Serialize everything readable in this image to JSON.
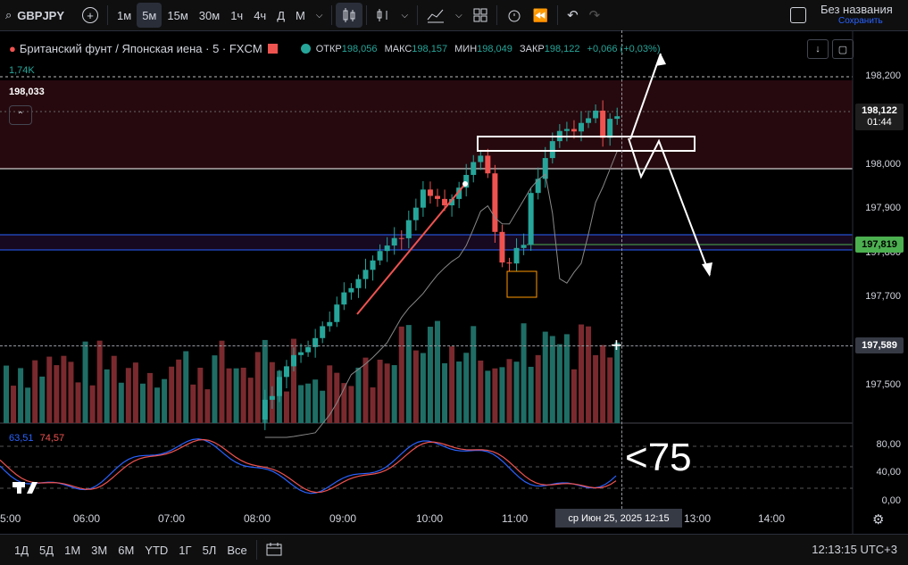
{
  "toolbar": {
    "symbol": "GBPJPY",
    "intervals": [
      "1м",
      "5м",
      "15м",
      "30м",
      "1ч",
      "4ч",
      "Д",
      "М"
    ],
    "active_interval": "5м",
    "layout_title": "Без названия",
    "layout_sub": "Сохранить"
  },
  "legend": {
    "title": "Британский фунт / Японская иена · 5 · FXCM",
    "open_lbl": "ОТКР",
    "open": "198,056",
    "high_lbl": "МАКС",
    "high": "198,157",
    "low_lbl": "МИН",
    "low": "198,049",
    "close_lbl": "ЗАКР",
    "close": "198,122",
    "change": "+0,066 (+0,03%)",
    "volume": "1,74K",
    "crosshair_price": "198,033"
  },
  "price_axis": {
    "ticks": [
      "198,200",
      "198,000",
      "197,900",
      "197,800",
      "197,700",
      "197,500"
    ],
    "current_price": "198,122",
    "countdown": "01:44",
    "level_price": "197,819",
    "cross_price": "197,589"
  },
  "rsi": {
    "value1": "63,51",
    "value2": "74,57",
    "ticks": [
      "80,00",
      "40,00",
      "0,00"
    ]
  },
  "time_axis": {
    "ticks": [
      "5:00",
      "06:00",
      "07:00",
      "08:00",
      "09:00",
      "10:00",
      "11:00",
      "13:00",
      "14:00"
    ],
    "crosshair_time": "ср Июн 25, 2025   12:15"
  },
  "bottom": {
    "ranges": [
      "1Д",
      "5Д",
      "1М",
      "3М",
      "6М",
      "YTD",
      "1Г",
      "5Л",
      "Все"
    ],
    "clock": "12:13:15 UTC+3"
  },
  "annotation": "<75",
  "colors": {
    "up": "#26a69a",
    "down": "#ef5350",
    "bg": "#000000"
  }
}
